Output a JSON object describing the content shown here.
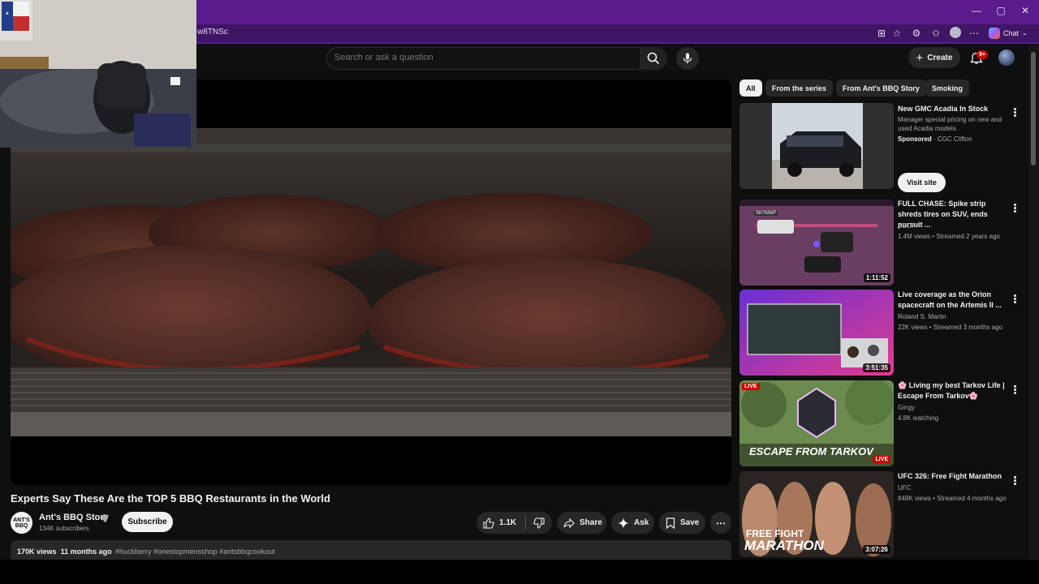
{
  "browser": {
    "url_fragment": "w8TNSc",
    "window_controls": [
      "—",
      "▢",
      "✕"
    ],
    "chat_label": "Chat"
  },
  "header": {
    "search_placeholder": "Search or ask a question",
    "create_label": "Create",
    "notifications_count": "9+"
  },
  "video": {
    "title": "Experts Say These Are the TOP 5 BBQ Restaurants in the World",
    "channel_name": "Ant's BBQ Story",
    "channel_avatar_text": "ANT'S BBQ",
    "subscribers": "134K subscribers",
    "subscribe_label": "Subscribe",
    "likes": "1.1K",
    "share_label": "Share",
    "ask_label": "Ask",
    "save_label": "Save",
    "views": "170K views",
    "age": "11 months ago",
    "tags": "#huckberry #onestopmensshop #antsbbqcookout"
  },
  "chips": [
    {
      "label": "All",
      "active": true
    },
    {
      "label": "From the series"
    },
    {
      "label": "From Ant's BBQ Story"
    },
    {
      "label": "Smoking"
    }
  ],
  "recommendations": [
    {
      "title": "New GMC Acadia In Stock",
      "description": "Manager special pricing on new and used Acadia models.",
      "sponsored": "Sponsored",
      "advertiser": "· CGC Clifton",
      "cta": "Visit site"
    },
    {
      "title": "FULL CHASE: Spike strip shreds tires on SUV, ends pursuit ...",
      "channel": "ABC7",
      "meta": "1.4M views • Streamed 2 years ago",
      "duration": "1:11:52",
      "thumb_caption": "SKYMAP"
    },
    {
      "title": "Live coverage as the Orion spacecraft on the Artemis II ...",
      "channel": "Roland S. Martin",
      "meta": "22K views • Streamed 3 months ago",
      "duration": "3:51:35"
    },
    {
      "title": "🌸 Living my best Tarkov Life | Escape From Tarkov🌸",
      "channel": "Gingy",
      "meta": "4.8K watching",
      "live_badge": "LIVE",
      "thumb_text": "ESCAPE FROM TARKOV",
      "thumb_live": "LIVE"
    },
    {
      "title": "UFC 326: Free Fight Marathon",
      "channel": "UFC",
      "meta": "848K views • Streamed 4 months ago",
      "duration": "3:07:26",
      "thumb_line1": "FREE FIGHT",
      "thumb_line2": "MARATHON"
    }
  ],
  "colors": {
    "browser_purple": "#5a1c8c",
    "yt_background": "#0f0f0f",
    "pill": "#272727",
    "live_red": "#cc0000"
  }
}
